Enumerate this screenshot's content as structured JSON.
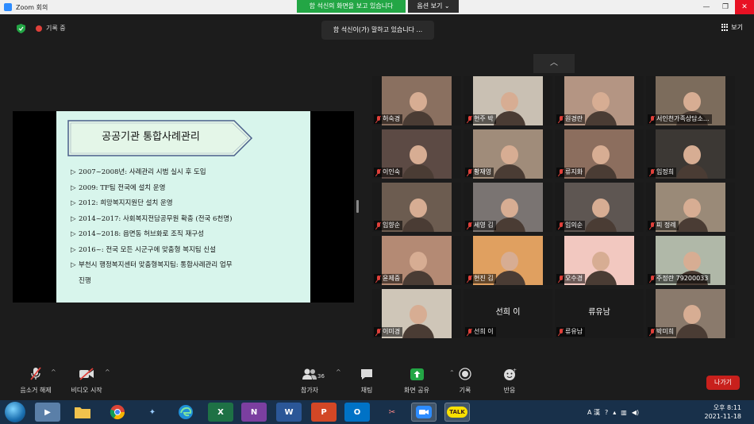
{
  "window": {
    "title": "Zoom 회의",
    "controls": [
      "—",
      "❐",
      "✕"
    ]
  },
  "share_banner": "함 석신의 화면을 보고 있습니다",
  "view_options": "옵션 보기 ⌄",
  "status": {
    "recording_label": "기록 중",
    "speaking_toast": "함 석신이(가) 말하고 있습니다 ...",
    "gallery_toggle": "보기"
  },
  "slide": {
    "title": "공공기관 통합사례관리",
    "bullets": [
      {
        "mark": "▷",
        "text": "2007~2008년: 사례관리 시범 실시 후 도입"
      },
      {
        "mark": "▷",
        "text": "2009: TF팀 전국에 설치 운영"
      },
      {
        "mark": "▷",
        "text": "2012: 희망복지지원단 설치 운영"
      },
      {
        "mark": "▷",
        "text": "2014~2017: 사회복지전담공무원 확충 (전국 6천명)"
      },
      {
        "mark": "▷",
        "text": "2014~2018: 읍면동 허브화로 조직 재구성"
      },
      {
        "mark": "▷",
        "text": "2016~: 전국 모든 시군구에 맞춤형 복지팀 신설"
      },
      {
        "mark": "▷",
        "text": "부천시 행정복지센터 맞춤형복지팀: 통합사례관리 업무"
      }
    ],
    "bullet_continuation": "진행"
  },
  "participants": [
    {
      "name": "허숙경",
      "muted": true
    },
    {
      "name": "현주 박",
      "muted": true
    },
    {
      "name": "원경란",
      "muted": true
    },
    {
      "name": "서인천가족상담소...",
      "muted": true
    },
    {
      "name": "이인숙",
      "muted": true
    },
    {
      "name": "황재영",
      "muted": true
    },
    {
      "name": "류지화",
      "muted": true
    },
    {
      "name": "임정희",
      "muted": true
    },
    {
      "name": "임향순",
      "muted": true
    },
    {
      "name": "세영 김",
      "muted": true
    },
    {
      "name": "임의순",
      "muted": true
    },
    {
      "name": "피 정례",
      "muted": true
    },
    {
      "name": "윤제중",
      "muted": true
    },
    {
      "name": "현진 김",
      "muted": true
    },
    {
      "name": "오수경",
      "muted": true
    },
    {
      "name": "주정란 79200033",
      "muted": true
    },
    {
      "name": "이미경",
      "muted": true
    },
    {
      "name": "선희 이",
      "muted": true,
      "no_video": true,
      "display_name": "선희 이"
    },
    {
      "name": "류유남",
      "muted": true,
      "no_video": true,
      "display_name": "류유남"
    },
    {
      "name": "박미희",
      "muted": true
    }
  ],
  "toolbar": {
    "mute": "음소거 해제",
    "video": "비디오 시작",
    "participants": "참가자",
    "participants_count": "36",
    "chat": "채팅",
    "share": "화면 공유",
    "record": "기록",
    "reactions": "반응",
    "leave": "나가기"
  },
  "taskbar": {
    "apps": [
      "▶",
      "📁",
      "◎",
      "✦",
      "e",
      "X",
      "N",
      "W",
      "P",
      "O",
      "✂",
      "▣",
      "TALK"
    ],
    "time": "오후 8:11",
    "date": "2021-11-18",
    "ime": "A 漢"
  },
  "colors": {
    "share_green": "#23a645",
    "slide_bg": "#d8f5ec",
    "leave_red": "#c8201c",
    "taskbar": "#18304a"
  }
}
